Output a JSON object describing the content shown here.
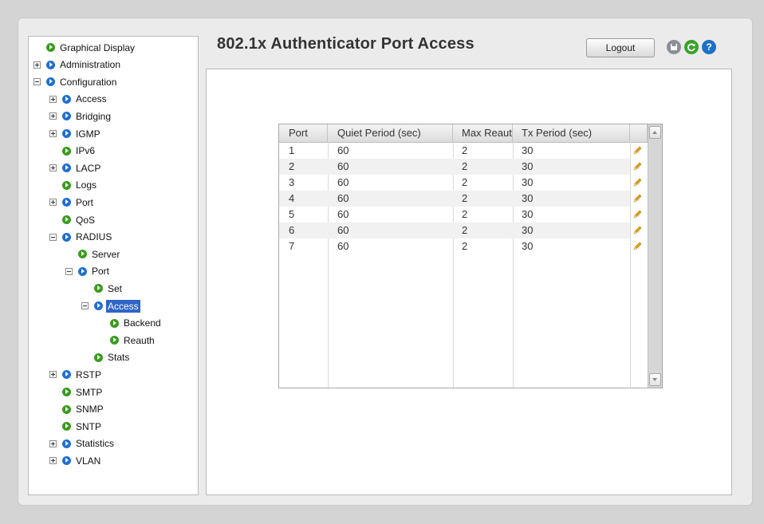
{
  "page": {
    "title": "802.1x Authenticator Port Access",
    "logout_label": "Logout"
  },
  "icons": {
    "save": "save-icon",
    "refresh": "refresh-icon",
    "help": "help-icon",
    "help_glyph": "?",
    "edit": "pencil-icon"
  },
  "colors": {
    "selected_node": "#2f64c8",
    "node_blue": "#1f6fd1",
    "node_green": "#3a9a1c",
    "pencil": "#e8a21a"
  },
  "nav": {
    "items": [
      {
        "label": "Graphical Display",
        "level": 0,
        "expander": "none",
        "icon": "green"
      },
      {
        "label": "Administration",
        "level": 0,
        "expander": "plus",
        "icon": "blue"
      },
      {
        "label": "Configuration",
        "level": 0,
        "expander": "minus",
        "icon": "blue"
      },
      {
        "label": "Access",
        "level": 1,
        "expander": "plus",
        "icon": "blue"
      },
      {
        "label": "Bridging",
        "level": 1,
        "expander": "plus",
        "icon": "blue"
      },
      {
        "label": "IGMP",
        "level": 1,
        "expander": "plus",
        "icon": "blue"
      },
      {
        "label": "IPv6",
        "level": 1,
        "expander": "none",
        "icon": "green"
      },
      {
        "label": "LACP",
        "level": 1,
        "expander": "plus",
        "icon": "blue"
      },
      {
        "label": "Logs",
        "level": 1,
        "expander": "none",
        "icon": "green"
      },
      {
        "label": "Port",
        "level": 1,
        "expander": "plus",
        "icon": "blue"
      },
      {
        "label": "QoS",
        "level": 1,
        "expander": "none",
        "icon": "green"
      },
      {
        "label": "RADIUS",
        "level": 1,
        "expander": "minus",
        "icon": "blue"
      },
      {
        "label": "Server",
        "level": 2,
        "expander": "none",
        "icon": "green"
      },
      {
        "label": "Port",
        "level": 2,
        "expander": "minus",
        "icon": "blue"
      },
      {
        "label": "Set",
        "level": 3,
        "expander": "none",
        "icon": "green"
      },
      {
        "label": "Access",
        "level": 3,
        "expander": "minus",
        "icon": "blue",
        "selected": true
      },
      {
        "label": "Backend",
        "level": 4,
        "expander": "none",
        "icon": "green"
      },
      {
        "label": "Reauth",
        "level": 4,
        "expander": "none",
        "icon": "green"
      },
      {
        "label": "Stats",
        "level": 3,
        "expander": "none",
        "icon": "green"
      },
      {
        "label": "RSTP",
        "level": 1,
        "expander": "plus",
        "icon": "blue"
      },
      {
        "label": "SMTP",
        "level": 1,
        "expander": "none",
        "icon": "green"
      },
      {
        "label": "SNMP",
        "level": 1,
        "expander": "none",
        "icon": "green"
      },
      {
        "label": "SNTP",
        "level": 1,
        "expander": "none",
        "icon": "green"
      },
      {
        "label": "Statistics",
        "level": 1,
        "expander": "plus",
        "icon": "blue"
      },
      {
        "label": "VLAN",
        "level": 1,
        "expander": "plus",
        "icon": "blue"
      }
    ]
  },
  "table": {
    "columns": [
      "Port",
      "Quiet Period (sec)",
      "Max Reauth",
      "Tx Period (sec)"
    ],
    "rows": [
      [
        "1",
        "60",
        "2",
        "30"
      ],
      [
        "2",
        "60",
        "2",
        "30"
      ],
      [
        "3",
        "60",
        "2",
        "30"
      ],
      [
        "4",
        "60",
        "2",
        "30"
      ],
      [
        "5",
        "60",
        "2",
        "30"
      ],
      [
        "6",
        "60",
        "2",
        "30"
      ],
      [
        "7",
        "60",
        "2",
        "30"
      ]
    ]
  }
}
